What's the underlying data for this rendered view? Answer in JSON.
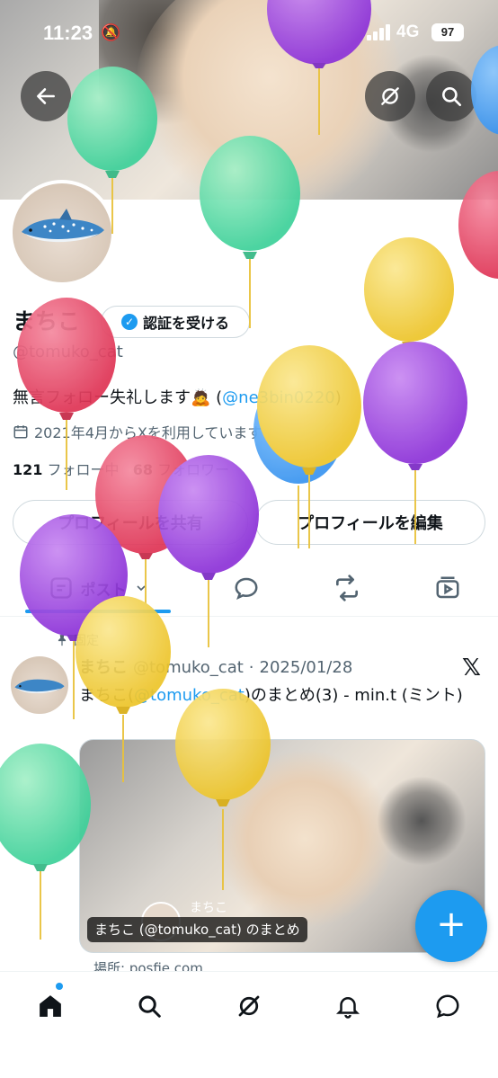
{
  "status_bar": {
    "time": "11:23",
    "network": "4G",
    "battery": "97"
  },
  "profile": {
    "name": "まちこ",
    "verify_label": "認証を受ける",
    "handle": "@tomuko_cat",
    "bio_text": "無言フォロー失礼します🙇 (",
    "bio_mention": "@ne3bin0220",
    "bio_tail": ")",
    "joined": "2021年4月からXを利用しています",
    "following_count": "121",
    "following_label": "フォロー中",
    "followers_count": "68",
    "followers_label": "フォロワー"
  },
  "actions": {
    "share_profile": "プロフィールを共有",
    "edit_profile": "プロフィールを編集"
  },
  "tabs": {
    "posts_label": "ポスト"
  },
  "post": {
    "pinned_label": "固定",
    "author": "まちこ",
    "author_handle": "@tomuko_cat",
    "dot": "·",
    "date": "2025/01/28",
    "text_before": "まちこ(",
    "text_mention": "@tomuko_cat",
    "text_after": ")のまとめ(3) - min.t (ミント)",
    "card_caption": "まちこ (@tomuko_cat) のまとめ",
    "card_inner_name": "まちこ",
    "card_source": "場所: posfie.com"
  },
  "icons": {
    "back": "arrow-left-icon",
    "grok": "grok-icon",
    "search": "search-icon",
    "fab": "plus-icon"
  },
  "colors": {
    "accent": "#1d9bf0",
    "text": "#0f1419",
    "muted": "#536471"
  }
}
